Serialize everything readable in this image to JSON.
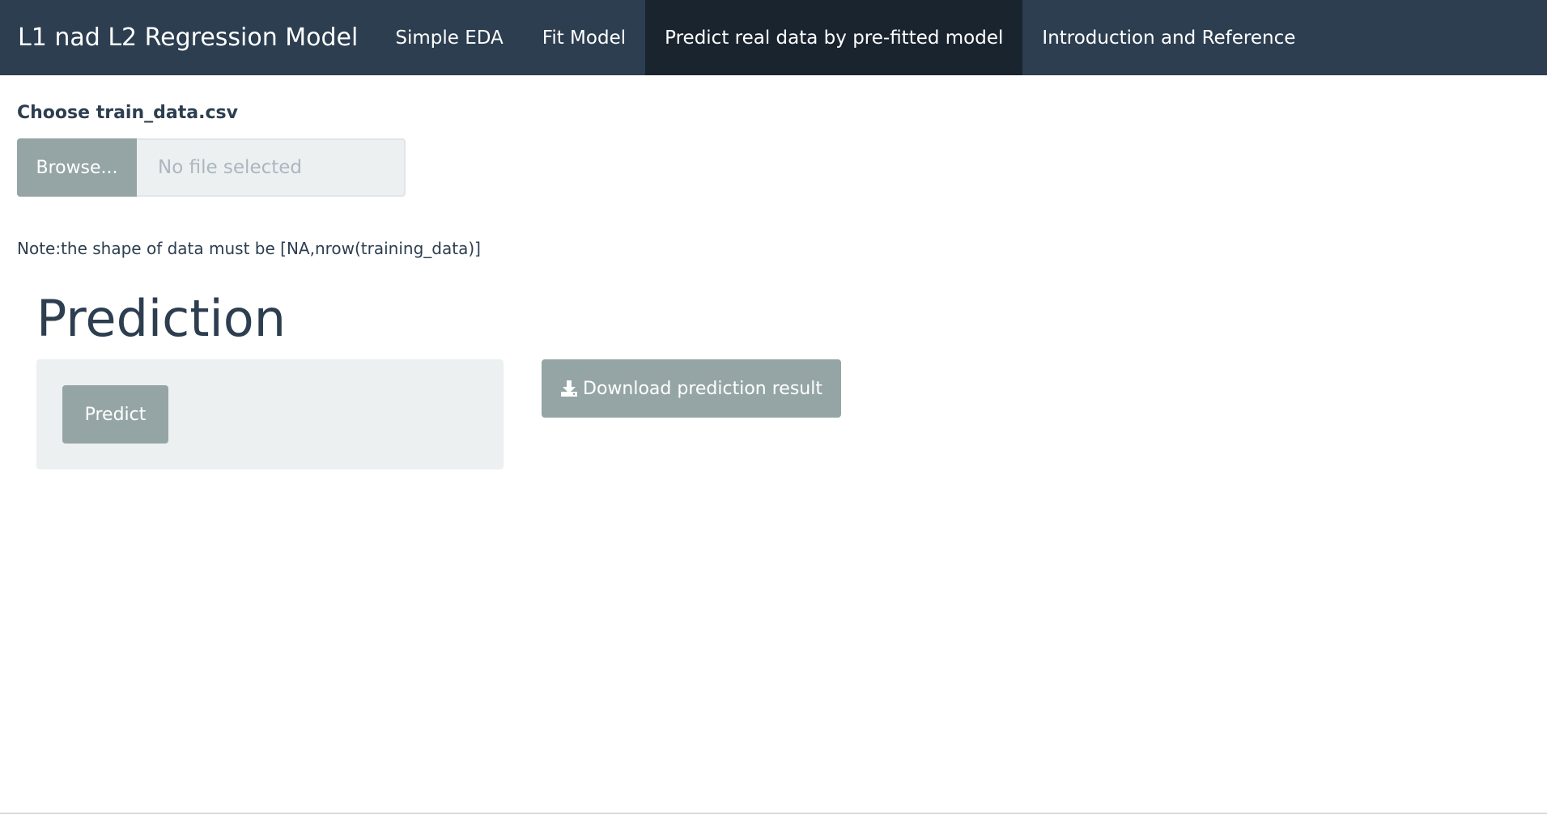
{
  "navbar": {
    "brand": "L1 nad L2 Regression Model",
    "tabs": [
      {
        "label": "Simple EDA",
        "active": false
      },
      {
        "label": "Fit Model",
        "active": false
      },
      {
        "label": "Predict real data by pre-fitted model",
        "active": true
      },
      {
        "label": "Introduction and Reference",
        "active": false
      }
    ]
  },
  "upload": {
    "label": "Choose train_data.csv",
    "browse_label": "Browse...",
    "placeholder": "No file selected"
  },
  "note": "Note:the shape of data must be [NA,nrow(training_data)]",
  "prediction": {
    "heading": "Prediction",
    "predict_label": "Predict",
    "download_label": "Download prediction result",
    "download_icon": "download-icon"
  },
  "colors": {
    "navbar_bg": "#2c3e50",
    "navbar_active": "#1a242f",
    "button_bg": "#95a5a6",
    "well_bg": "#ecf0f1",
    "text": "#2c3e50"
  }
}
